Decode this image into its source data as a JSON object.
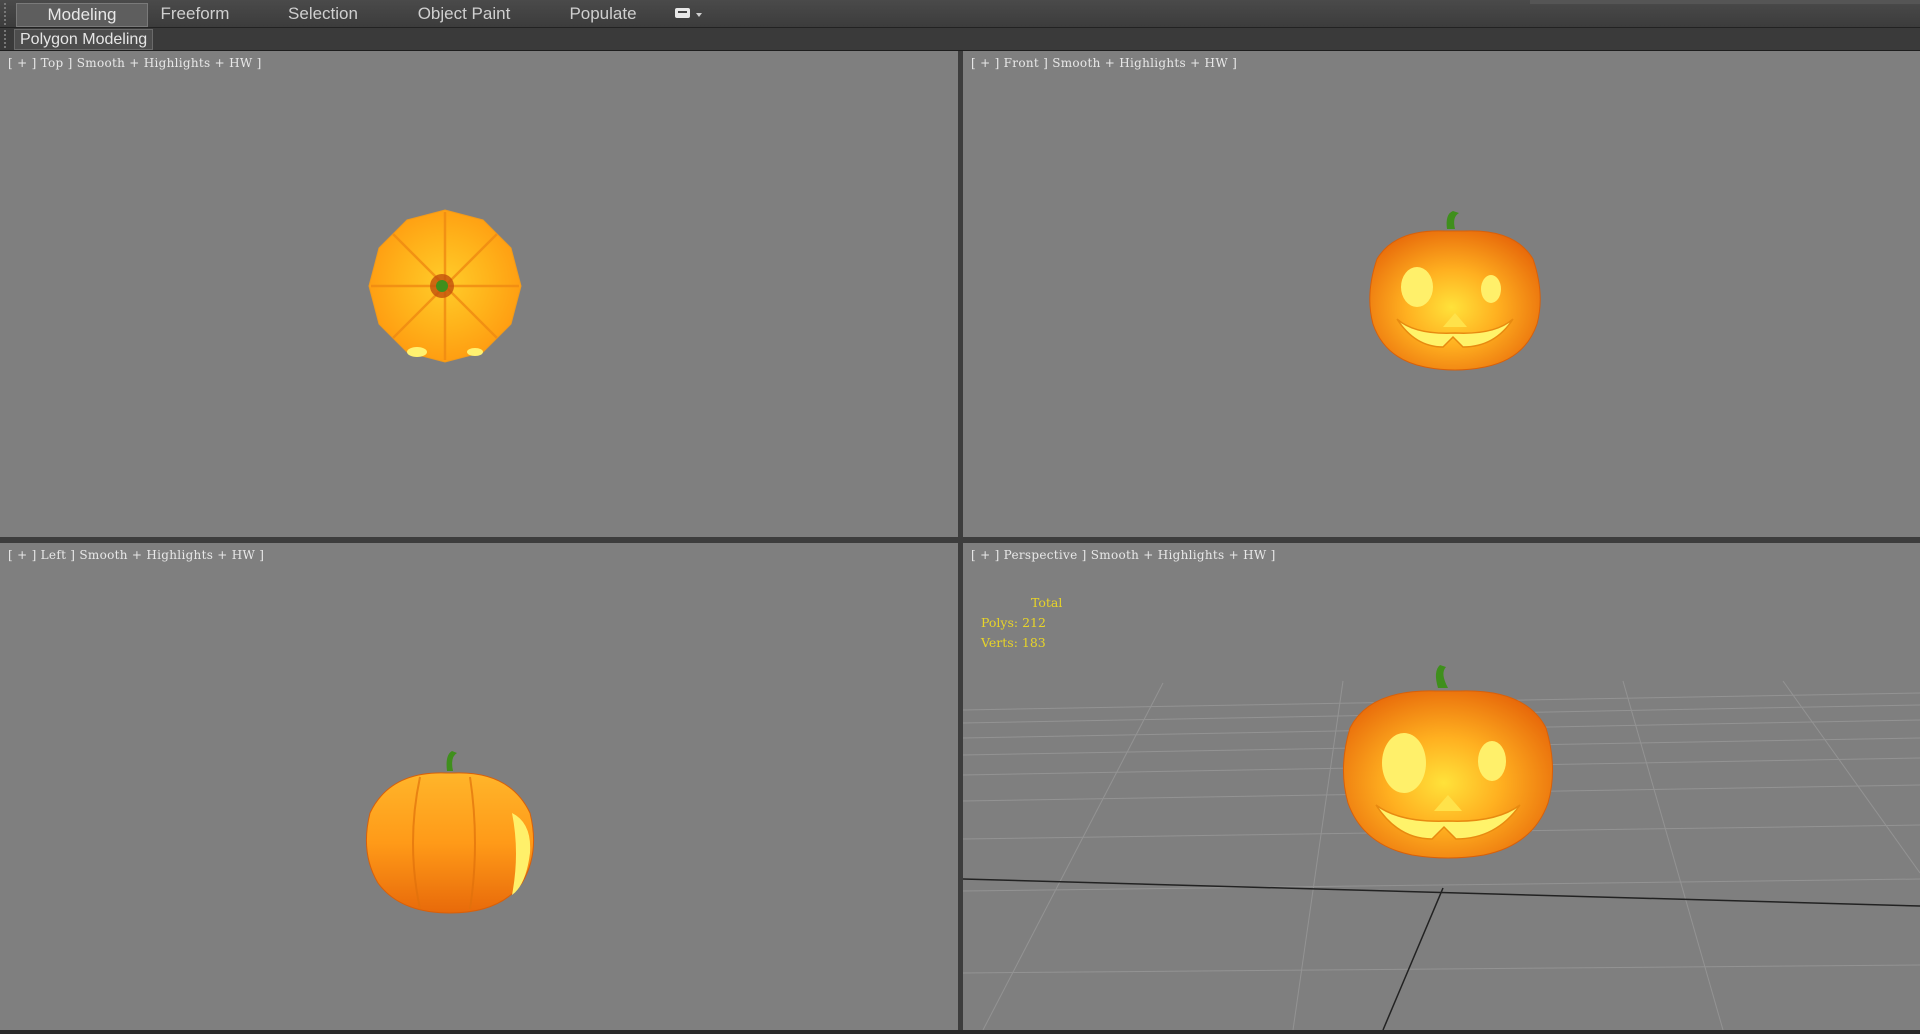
{
  "ribbon": {
    "tabs": [
      {
        "label": "Modeling",
        "active": true
      },
      {
        "label": "Freeform",
        "active": false
      },
      {
        "label": "Selection",
        "active": false
      },
      {
        "label": "Object Paint",
        "active": false
      },
      {
        "label": "Populate",
        "active": false
      }
    ],
    "extra_icon": "panel-toggle-icon"
  },
  "panel": {
    "label": "Polygon Modeling"
  },
  "viewports": {
    "top": {
      "label": "[ + ] Top ] Smooth + Highlights + HW ]"
    },
    "front": {
      "label": "[ + ] Front ] Smooth + Highlights + HW ]"
    },
    "left": {
      "label": "[ + ] Left ] Smooth + Highlights + HW ]"
    },
    "perspective": {
      "label": "[ + ] Perspective ] Smooth + Highlights + HW ]"
    }
  },
  "stats": {
    "header": "Total",
    "polys": "Polys: 212",
    "verts": "Verts: 183"
  },
  "colors": {
    "viewport_bg": "#7f7f7f",
    "stats_text": "#e8d428",
    "pumpkin_light": "#ffe23a",
    "pumpkin_dark": "#e86a0a",
    "stem": "#3f8f1c"
  }
}
